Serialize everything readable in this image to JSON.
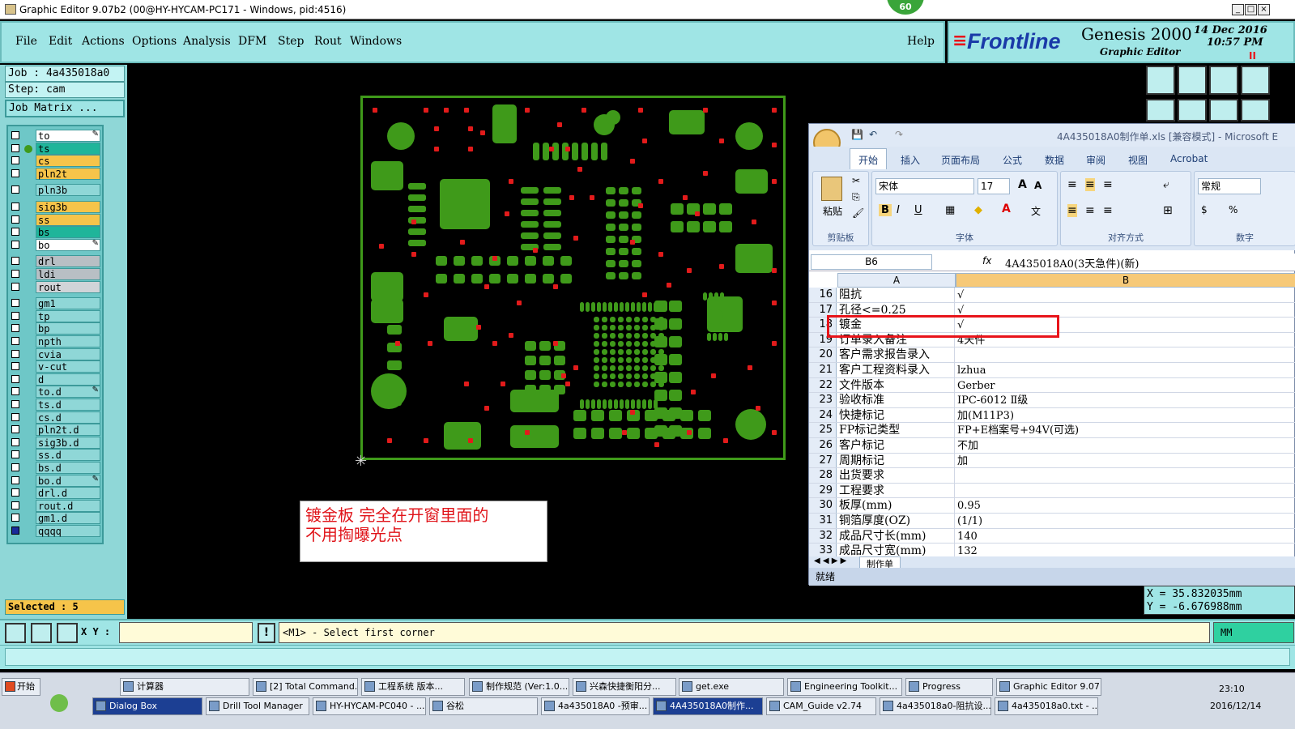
{
  "window": {
    "title": "Graphic Editor 9.07b2 (00@HY-HYCAM-PC171 - Windows, pid:4516)",
    "badge": "60"
  },
  "menu": [
    "File",
    "Edit",
    "Actions",
    "Options",
    "Analysis",
    "DFM",
    "Step",
    "Rout",
    "Windows"
  ],
  "help_label": "Help",
  "brand": {
    "logo": "Frontline",
    "product": "Genesis 2000",
    "subtitle": "Graphic Editor",
    "date": "14 Dec 2016",
    "time": "10:57 PM"
  },
  "job": {
    "job_label": "Job : 4a435018a0",
    "step_label": "Step: cam",
    "matrix_button": "Job Matrix ..."
  },
  "layers": [
    {
      "name": "to",
      "color": "#ffffff",
      "active": false,
      "mark": true
    },
    {
      "name": "ts",
      "color": "#1fb59a",
      "active": true,
      "mark": false
    },
    {
      "name": "cs",
      "color": "#f6c44a",
      "active": false,
      "mark": false
    },
    {
      "name": "pln2t",
      "color": "#f6c44a",
      "active": false,
      "mark": false
    },
    {
      "name": "pln3b",
      "color": "#8fd7d7",
      "active": false,
      "mark": false
    },
    {
      "name": "sig3b",
      "color": "#f6c44a",
      "active": false,
      "mark": false
    },
    {
      "name": "ss",
      "color": "#f6c44a",
      "active": false,
      "mark": false
    },
    {
      "name": "bs",
      "color": "#1fb59a",
      "active": false,
      "mark": false
    },
    {
      "name": "bo",
      "color": "#ffffff",
      "active": false,
      "mark": true
    },
    {
      "name": "drl",
      "color": "#b8bfc4",
      "active": false,
      "mark": false
    },
    {
      "name": "ldi",
      "color": "#b8bfc4",
      "active": false,
      "mark": false
    },
    {
      "name": "rout",
      "color": "#d0d4d8",
      "active": false,
      "mark": false
    },
    {
      "name": "gm1",
      "color": "#8fd7d7",
      "active": false,
      "mark": false
    },
    {
      "name": "tp",
      "color": "#8fd7d7",
      "active": false,
      "mark": false
    },
    {
      "name": "bp",
      "color": "#8fd7d7",
      "active": false,
      "mark": false
    },
    {
      "name": "npth",
      "color": "#8fd7d7",
      "active": false,
      "mark": false
    },
    {
      "name": "cvia",
      "color": "#8fd7d7",
      "active": false,
      "mark": false
    },
    {
      "name": "v-cut",
      "color": "#8fd7d7",
      "active": false,
      "mark": false
    },
    {
      "name": "d",
      "color": "#8fd7d7",
      "active": false,
      "mark": false
    },
    {
      "name": "to.d",
      "color": "#8fd7d7",
      "active": false,
      "mark": true
    },
    {
      "name": "ts.d",
      "color": "#8fd7d7",
      "active": false,
      "mark": false
    },
    {
      "name": "cs.d",
      "color": "#8fd7d7",
      "active": false,
      "mark": false
    },
    {
      "name": "pln2t.d",
      "color": "#8fd7d7",
      "active": false,
      "mark": false
    },
    {
      "name": "sig3b.d",
      "color": "#8fd7d7",
      "active": false,
      "mark": false
    },
    {
      "name": "ss.d",
      "color": "#8fd7d7",
      "active": false,
      "mark": false
    },
    {
      "name": "bs.d",
      "color": "#8fd7d7",
      "active": false,
      "mark": false
    },
    {
      "name": "bo.d",
      "color": "#8fd7d7",
      "active": false,
      "mark": true
    },
    {
      "name": "drl.d",
      "color": "#8fd7d7",
      "active": false,
      "mark": false
    },
    {
      "name": "rout.d",
      "color": "#8fd7d7",
      "active": false,
      "mark": false
    },
    {
      "name": "gm1.d",
      "color": "#8fd7d7",
      "active": false,
      "mark": false
    },
    {
      "name": "qqqq",
      "color": "#8fd7d7",
      "active": false,
      "mark": false
    }
  ],
  "selected_label": "Selected : 5",
  "note": {
    "line1": "镀金板   完全在开窗里面的",
    "line2": "不用掏曝光点"
  },
  "coords": {
    "x": "X  =  35.832035mm",
    "y": "Y  =  -6.676988mm"
  },
  "cmd": {
    "xy_label": "X Y :",
    "xy_value": "",
    "prompt": "<M1> - Select first corner",
    "units": "MM"
  },
  "excel": {
    "title": "4A435018A0制作单.xls [兼容模式] - Microsoft E",
    "tabs": [
      "开始",
      "插入",
      "页面布局",
      "公式",
      "数据",
      "审阅",
      "视图",
      "Acrobat"
    ],
    "font_name": "宋体",
    "font_size": "17",
    "number_format": "常规",
    "paste_label": "粘贴",
    "groups": [
      "剪贴板",
      "字体",
      "对齐方式",
      "数字"
    ],
    "cell_ref": "B6",
    "formula": "4A435018A0(3天急件)(新)",
    "col_a": "A",
    "col_b": "B",
    "rows": [
      {
        "n": "16",
        "a": "阻抗",
        "b": "√"
      },
      {
        "n": "17",
        "a": "孔径<=0.25",
        "b": "√"
      },
      {
        "n": "18",
        "a": "镀金",
        "b": "√"
      },
      {
        "n": "19",
        "a": "订单录入备注",
        "b": "4天件"
      },
      {
        "n": "20",
        "a": "客户需求报告录入",
        "b": ""
      },
      {
        "n": "21",
        "a": "客户工程资料录入",
        "b": "lzhua"
      },
      {
        "n": "22",
        "a": "文件版本",
        "b": "Gerber"
      },
      {
        "n": "23",
        "a": "验收标准",
        "b": "IPC-6012 Ⅱ级"
      },
      {
        "n": "24",
        "a": "快捷标记",
        "b": "加(M11P3)"
      },
      {
        "n": "25",
        "a": "FP标记类型",
        "b": "FP+E档案号+94V(可选)"
      },
      {
        "n": "26",
        "a": "客户标记",
        "b": "不加"
      },
      {
        "n": "27",
        "a": "周期标记",
        "b": "加"
      },
      {
        "n": "28",
        "a": "出货要求",
        "b": ""
      },
      {
        "n": "29",
        "a": "工程要求",
        "b": ""
      },
      {
        "n": "30",
        "a": "板厚(mm)",
        "b": "0.95"
      },
      {
        "n": "31",
        "a": "铜箔厚度(OZ)",
        "b": " (1/1)"
      },
      {
        "n": "32",
        "a": "成品尺寸长(mm)",
        "b": "140"
      },
      {
        "n": "33",
        "a": "成品尺寸宽(mm)",
        "b": "132"
      }
    ],
    "sheet_tab": "制作单",
    "status": "就绪"
  },
  "taskbar": {
    "start": "开始",
    "row1": [
      "计算器",
      "[2] Total Command...",
      "工程系统  版本...",
      "制作规范 (Ver:1.0...",
      "兴森快捷衡阳分...",
      "get.exe",
      "Engineering Toolkit...",
      "Progress",
      "Graphic Editor 9.07..."
    ],
    "row2": [
      "Dialog Box",
      "Drill Tool Manager",
      "HY-HYCAM-PC040 - ...",
      "谷松",
      "4a435018A0 -预审...",
      "4A435018A0制作...",
      "CAM_Guide v2.74",
      "4a435018a0-阻抗设...",
      "4a435018a0.txt - ..."
    ],
    "clock_time": "23:10",
    "clock_date": "2016/12/14"
  }
}
